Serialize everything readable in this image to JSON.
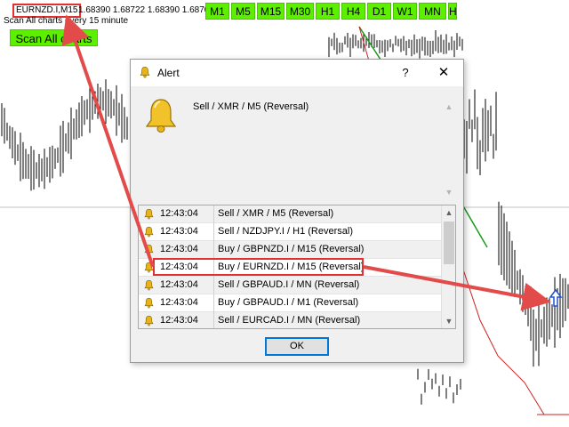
{
  "chart": {
    "symbol_label": "EURNZD.I,M15",
    "prices": "1.68390 1.68722 1.68390 1.68703",
    "scan_note": "Scan All charts every 15 minute",
    "scan_button": "Scan All charts",
    "timeframes": [
      "M1",
      "M5",
      "M15",
      "M30",
      "H1",
      "H4",
      "D1",
      "W1",
      "MN",
      "H"
    ],
    "button_color": "#5cf000"
  },
  "dialog": {
    "title": "Alert",
    "help": "?",
    "close": "✕",
    "message": "Sell / XMR / M5 (Reversal)",
    "ok": "OK",
    "alerts": [
      {
        "time": "12:43:04",
        "text": "Sell / XMR / M5 (Reversal)"
      },
      {
        "time": "12:43:04",
        "text": "Sell / NZDJPY.I / H1 (Reversal)"
      },
      {
        "time": "12:43:04",
        "text": "Buy / GBPNZD.I / M15 (Reversal)"
      },
      {
        "time": "12:43:04",
        "text": "Buy / EURNZD.I / M15 (Reversal)"
      },
      {
        "time": "12:43:04",
        "text": "Sell / GBPAUD.I / MN (Reversal)"
      },
      {
        "time": "12:43:04",
        "text": "Buy / GBPAUD.I / M1 (Reversal)"
      },
      {
        "time": "12:43:04",
        "text": "Sell / EURCAD.I / MN (Reversal)"
      }
    ]
  },
  "colors": {
    "annotation_red": "#e34a4a",
    "bell_gold": "#e8b41a",
    "focus_blue": "#0078d7",
    "trend_green": "#1a9a1a",
    "trend_red": "#d02020"
  },
  "icons": {
    "bell": "bell-icon",
    "up_arrow": "up-arrow-icon"
  }
}
